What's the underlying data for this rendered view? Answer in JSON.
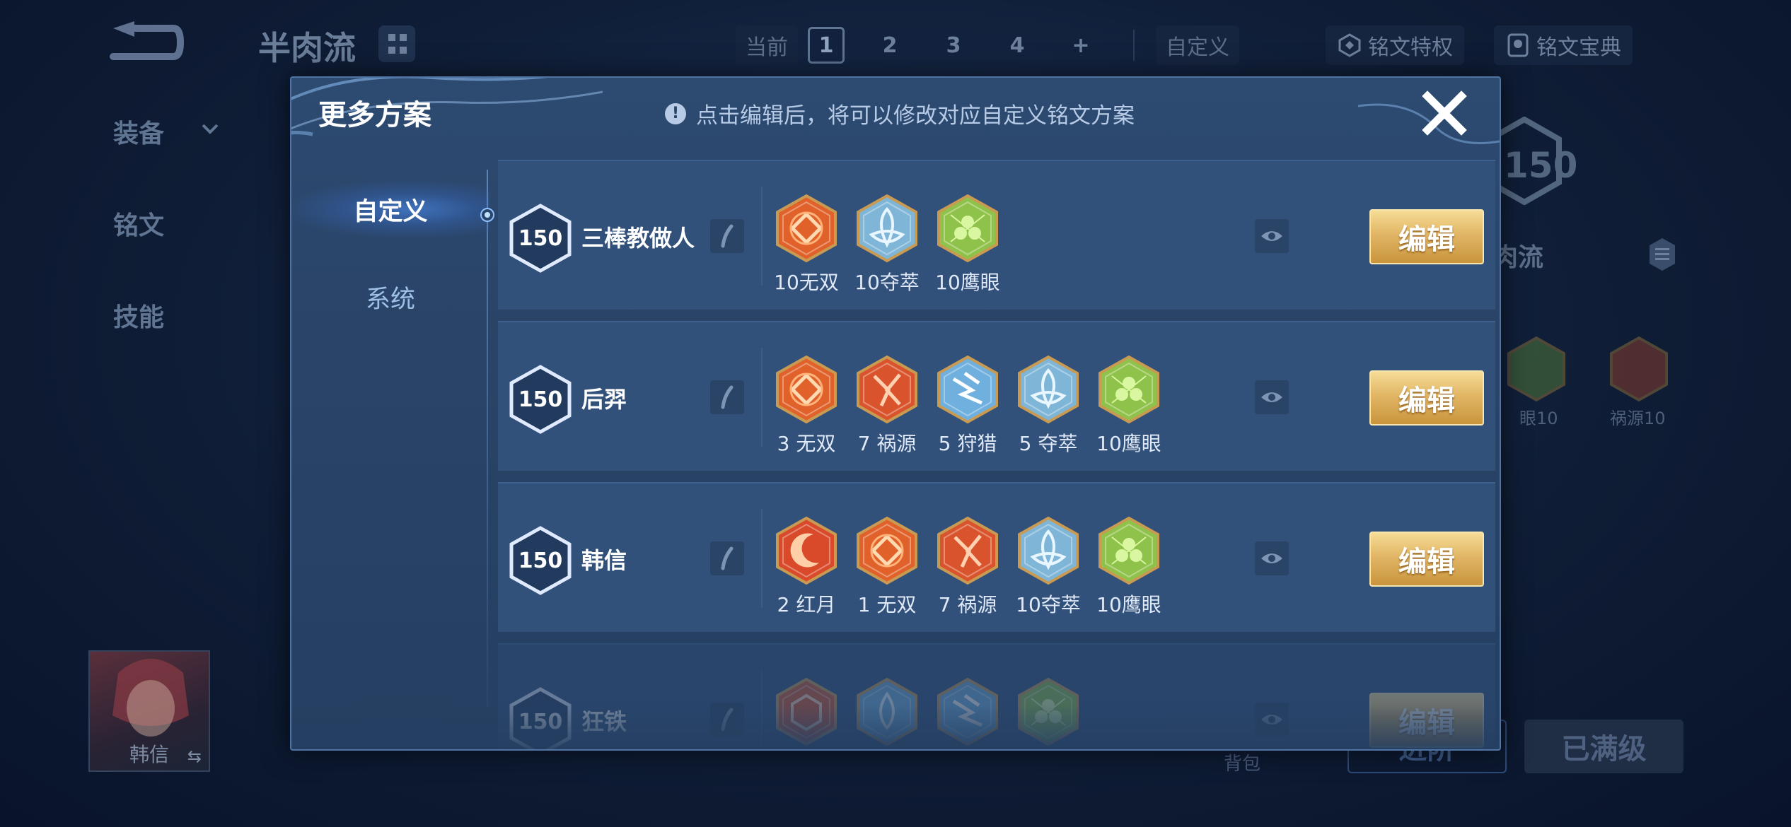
{
  "background": {
    "scheme_title": "半肉流",
    "top_tabs": {
      "current_label": "当前",
      "numbers": [
        "1",
        "2",
        "3",
        "4",
        "+"
      ],
      "custom_label": "自定义"
    },
    "privilege_btn": "铭文特权",
    "codex_btn": "铭文宝典",
    "side_nav": [
      "装备",
      "铭文",
      "技能"
    ],
    "hero_name": "韩信",
    "right_level": "150",
    "right_scheme_label": "肉流",
    "right_runes": [
      "眼10",
      "祸源10"
    ],
    "backpack_label": "背包",
    "upgrade_btn": "进阶",
    "maxed_btn": "已满级"
  },
  "modal": {
    "title": "更多方案",
    "notice": "点击编辑后，将可以修改对应自定义铭文方案",
    "nav": [
      {
        "label": "自定义",
        "active": true
      },
      {
        "label": "系统",
        "active": false
      }
    ],
    "edit_label": "编辑",
    "schemes": [
      {
        "level": "150",
        "name": "三棒教做人",
        "runes": [
          {
            "label": "10无双",
            "icon": "wushuang-rune-icon",
            "color": "#e0622a"
          },
          {
            "label": "10夺萃",
            "icon": "duocui-rune-icon",
            "color": "#7fb6d8"
          },
          {
            "label": "10鹰眼",
            "icon": "yingyan-rune-icon",
            "color": "#8fc24a"
          }
        ]
      },
      {
        "level": "150",
        "name": "后羿",
        "runes": [
          {
            "label": "3 无双",
            "icon": "wushuang-rune-icon",
            "color": "#e0622a"
          },
          {
            "label": "7 祸源",
            "icon": "huoyuan-rune-icon",
            "color": "#d9542c"
          },
          {
            "label": "5 狩猎",
            "icon": "shoulie-rune-icon",
            "color": "#6fb0de"
          },
          {
            "label": "5 夺萃",
            "icon": "duocui-rune-icon",
            "color": "#7fb6d8"
          },
          {
            "label": "10鹰眼",
            "icon": "yingyan-rune-icon",
            "color": "#8fc24a"
          }
        ]
      },
      {
        "level": "150",
        "name": "韩信",
        "runes": [
          {
            "label": "2 红月",
            "icon": "hongyue-rune-icon",
            "color": "#d94a2a"
          },
          {
            "label": "1 无双",
            "icon": "wushuang-rune-icon",
            "color": "#e0622a"
          },
          {
            "label": "7 祸源",
            "icon": "huoyuan-rune-icon",
            "color": "#d9542c"
          },
          {
            "label": "10夺萃",
            "icon": "duocui-rune-icon",
            "color": "#7fb6d8"
          },
          {
            "label": "10鹰眼",
            "icon": "yingyan-rune-icon",
            "color": "#8fc24a"
          }
        ]
      },
      {
        "level": "150",
        "name": "狂铁",
        "runes": [
          {
            "label": "",
            "icon": "red-rune-icon",
            "color": "#d9542c"
          },
          {
            "label": "",
            "icon": "blue-rune-icon",
            "color": "#6fb0de"
          },
          {
            "label": "",
            "icon": "shoulie-rune-icon",
            "color": "#6fb0de"
          },
          {
            "label": "",
            "icon": "yingyan-rune-icon",
            "color": "#8fc24a"
          }
        ]
      }
    ]
  }
}
